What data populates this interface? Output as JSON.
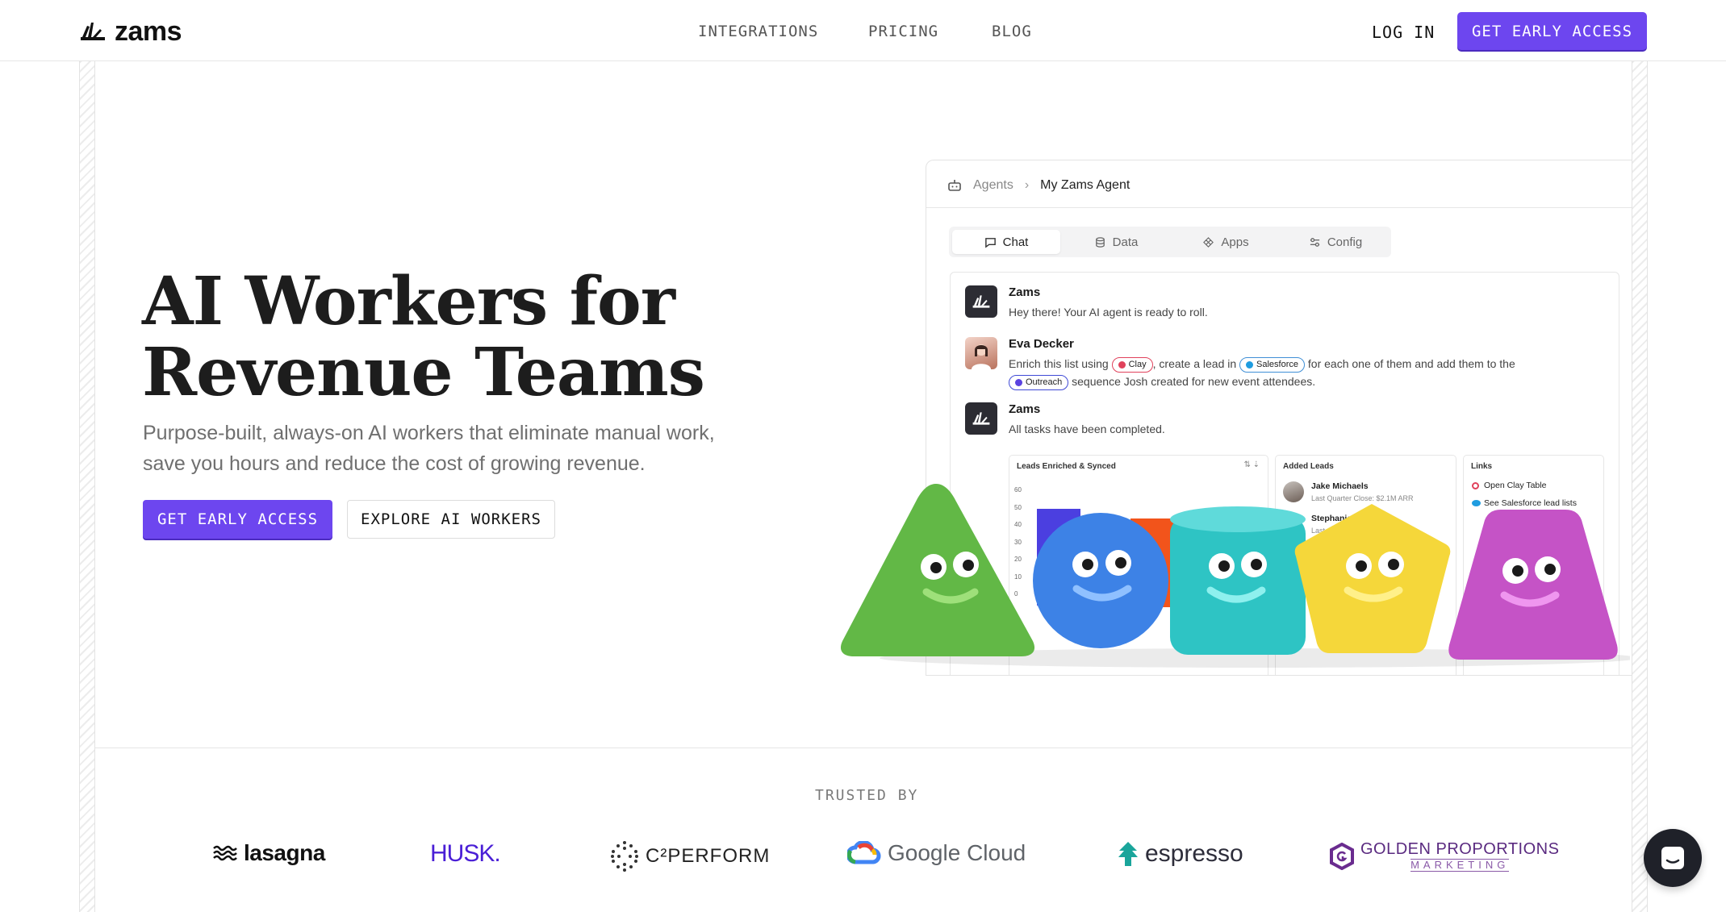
{
  "header": {
    "brand": "zams",
    "nav": [
      "INTEGRATIONS",
      "PRICING",
      "BLOG"
    ],
    "login": "LOG IN",
    "cta": "GET EARLY ACCESS"
  },
  "hero": {
    "title_line1": "AI Workers for",
    "title_line2": "Revenue Teams",
    "subtitle_line1": "Purpose-built, always-on AI workers that eliminate manual work,",
    "subtitle_line2": "save you hours and reduce the cost of growing revenue.",
    "primary_cta": "GET EARLY ACCESS",
    "secondary_cta": "EXPLORE AI WORKERS"
  },
  "app": {
    "breadcrumb": [
      "Agents",
      "My Zams Agent"
    ],
    "tabs": [
      "Chat",
      "Data",
      "Apps",
      "Config"
    ],
    "active_tab": "Chat",
    "messages": [
      {
        "name": "Zams",
        "text": "Hey there! Your AI agent is ready to roll."
      },
      {
        "name": "Eva Decker",
        "t1": "Enrich this list using",
        "pill1": "Clay",
        "t2": ", create a lead in",
        "pill2": "Salesforce",
        "t3": "for each one of them and add them to the",
        "pill3": "Outreach",
        "t4": "sequence Josh created for new event attendees."
      },
      {
        "name": "Zams",
        "text": "All tasks have been completed."
      }
    ],
    "cards": {
      "leads_title": "Leads Enriched & Synced",
      "y_ticks": [
        "60",
        "50",
        "40",
        "30",
        "20",
        "10",
        "0"
      ],
      "added_title": "Added Leads",
      "lead1_name": "Jake Michaels",
      "lead1_sub": "Last Quarter Close: $2.1M ARR",
      "lead2_name": "Stephanie",
      "lead2_sub": "Last",
      "links_title": "Links",
      "link1": "Open Clay Table",
      "link2": "See Salesforce lead lists"
    }
  },
  "trusted": {
    "label": "TRUSTED BY",
    "logos": [
      "lasagna",
      "HUSK.",
      "C²PERFORM",
      "Google Cloud",
      "espresso",
      "GOLDEN PROPORTIONS",
      "MARKETING"
    ]
  },
  "colors": {
    "accent": "#6d46ef",
    "text": "#1d1d1d",
    "muted": "#6f6f6f"
  }
}
